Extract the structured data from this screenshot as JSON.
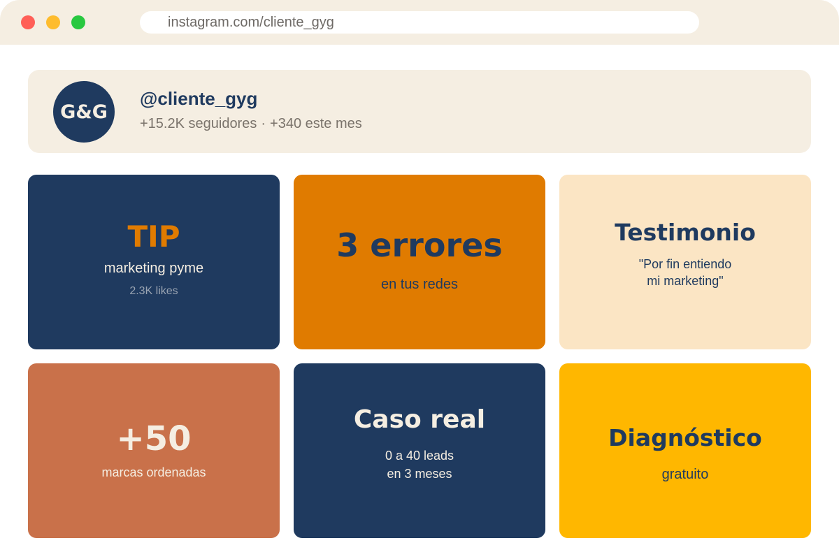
{
  "browser": {
    "url": "instagram.com/cliente_gyg"
  },
  "profile": {
    "avatar_text": "G&G",
    "handle": "@cliente_gyg",
    "followers": "+15.2K seguidores",
    "separator": "·",
    "monthly_growth": "+340 este mes"
  },
  "posts": [
    {
      "title": "TIP",
      "subtitle": "marketing pyme",
      "meta": "2.3K likes"
    },
    {
      "title": "3 errores",
      "subtitle": "en tus redes"
    },
    {
      "title": "Testimonio",
      "quote_line1": "\"Por fin entiendo",
      "quote_line2": "mi marketing\""
    },
    {
      "title": "+50",
      "subtitle": "marcas ordenadas"
    },
    {
      "title": "Caso real",
      "line1": "0 a 40 leads",
      "line2": "en 3 meses"
    },
    {
      "title": "Diagnóstico",
      "subtitle": "gratuito"
    }
  ],
  "colors": {
    "navy": "#1f3a5f",
    "orange": "#e07b00",
    "peach": "#fbe5c4",
    "terracotta": "#c9714a",
    "amber": "#ffb700",
    "cream": "#f5eee2"
  }
}
